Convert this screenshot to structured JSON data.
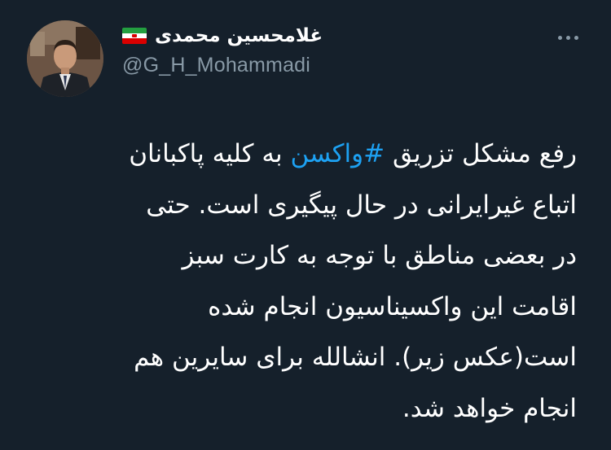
{
  "tweet": {
    "author": {
      "display_name": "غلامحسین محمدی",
      "handle": "@G_H_Mohammadi",
      "flag_icon": "iran-flag-icon"
    },
    "more_icon": "more-options-icon",
    "text": {
      "line1_before": "رفع مشکل تزریق ",
      "hashtag": "#واکسن",
      "line1_after": " به کلیه پاکبانان",
      "line2": "اتباع غیرایرانی در حال پیگیری است. حتی",
      "line3": "در بعضی مناطق با توجه به کارت سبز",
      "line4": "اقامت این واکسیناسیون انجام شده",
      "line5": "است(عکس زیر). انشالله برای سایرین هم",
      "line6": "انجام خواهد شد."
    }
  },
  "colors": {
    "background": "#15202b",
    "text": "#ffffff",
    "secondary": "#8899a6",
    "link": "#1da1f2"
  }
}
